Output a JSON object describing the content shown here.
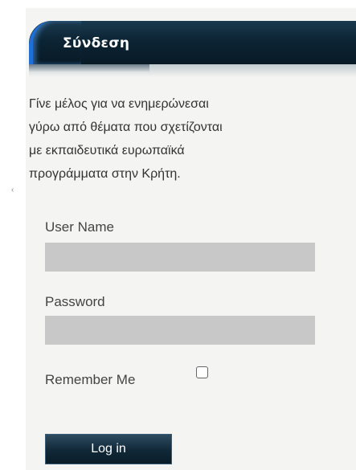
{
  "login_panel": {
    "title": "Σύνδεση",
    "intro_lines": [
      "Γίνε μέλος για να ενημερώνεσαι",
      "γύρω από θέματα που σχετίζονται",
      "με εκπαιδευτικά ευρωπαϊκά",
      "προγράμματα στην Κρήτη."
    ],
    "username_label": "User Name",
    "username_value": "",
    "password_label": "Password",
    "password_value": "",
    "remember_label": "Remember Me",
    "remember_checked": false,
    "login_label": "Log in"
  },
  "colors": {
    "header_bg": "#0c2434",
    "header_accent": "#1f6fd6",
    "input_bg": "#c8c8c8",
    "button_bg": "#102838",
    "panel_bg": "#f4f4f2"
  }
}
